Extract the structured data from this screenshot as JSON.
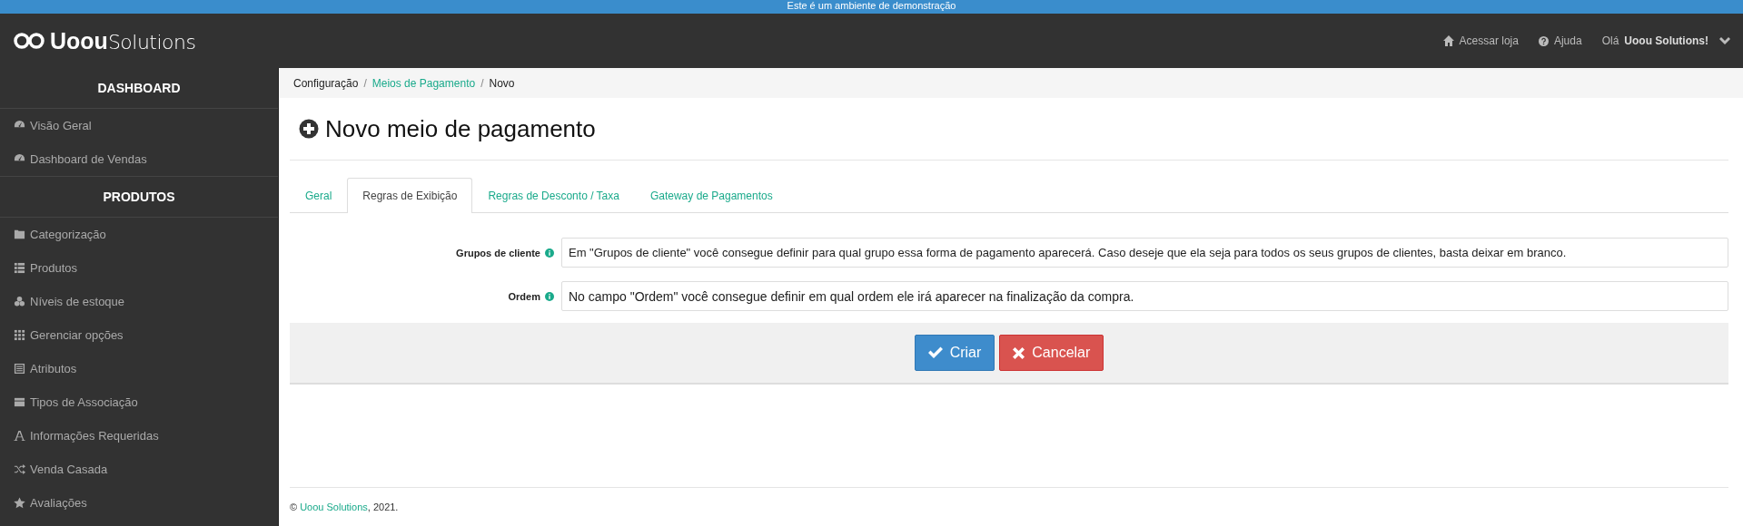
{
  "demo_banner": "Este é um ambiente de demonstração",
  "header": {
    "logo_bold": "Uoou",
    "logo_light": "Solutions",
    "links": [
      "Acessar loja",
      "Ajuda"
    ],
    "greeting": "Olá",
    "user": "Uoou Solutions!"
  },
  "sidebar": {
    "sections": [
      {
        "title": "DASHBOARD",
        "items": [
          {
            "label": "Visão Geral",
            "selected": false
          },
          {
            "label": "Dashboard de Vendas",
            "selected": false
          }
        ]
      },
      {
        "title": "PRODUTOS",
        "items": [
          {
            "label": "Categorização",
            "selected": false
          },
          {
            "label": "Produtos",
            "selected": false
          },
          {
            "label": "Níveis de estoque",
            "selected": false
          },
          {
            "label": "Gerenciar opções",
            "selected": false
          },
          {
            "label": "Atributos",
            "selected": false
          },
          {
            "label": "Tipos de Associação",
            "selected": false
          },
          {
            "label": "Informações Requeridas",
            "selected": false
          },
          {
            "label": "Venda Casada",
            "selected": false
          },
          {
            "label": "Avaliações",
            "selected": false
          }
        ]
      }
    ]
  },
  "breadcrumb": [
    {
      "label": "Configuração",
      "link": false
    },
    {
      "separator": "/",
      "label": "Meios de Pagamento",
      "link": true
    },
    {
      "separator": "/",
      "label": "Novo",
      "link": false
    }
  ],
  "title": "Novo meio de pagamento",
  "tabs": [
    {
      "label": "Geral",
      "selected": false
    },
    {
      "label": "Regras de Exibição",
      "selected": true
    },
    {
      "label": "Regras de Desconto / Taxa",
      "selected": false
    },
    {
      "label": "Gateway de Pagamentos",
      "selected": false
    }
  ],
  "fields": [
    {
      "label": "Grupos de cliente",
      "kind": "select",
      "value": "Em \"Grupos de cliente\" você consegue definir para qual grupo essa forma de pagamento aparecerá. Caso deseje que ela seja para todos os seus grupos de clientes, basta deixar em branco."
    },
    {
      "label": "Ordem",
      "kind": "text",
      "value": "No campo \"Ordem\" você consegue definir em qual ordem ele irá aparecer na finalização da compra."
    }
  ],
  "buttons": [
    {
      "label": "Criar",
      "kind": "primary"
    },
    {
      "label": "Cancelar",
      "kind": "danger"
    }
  ],
  "footer": {
    "symbol": "©",
    "company": "Uoou Solutions",
    "year": ", 2021."
  }
}
